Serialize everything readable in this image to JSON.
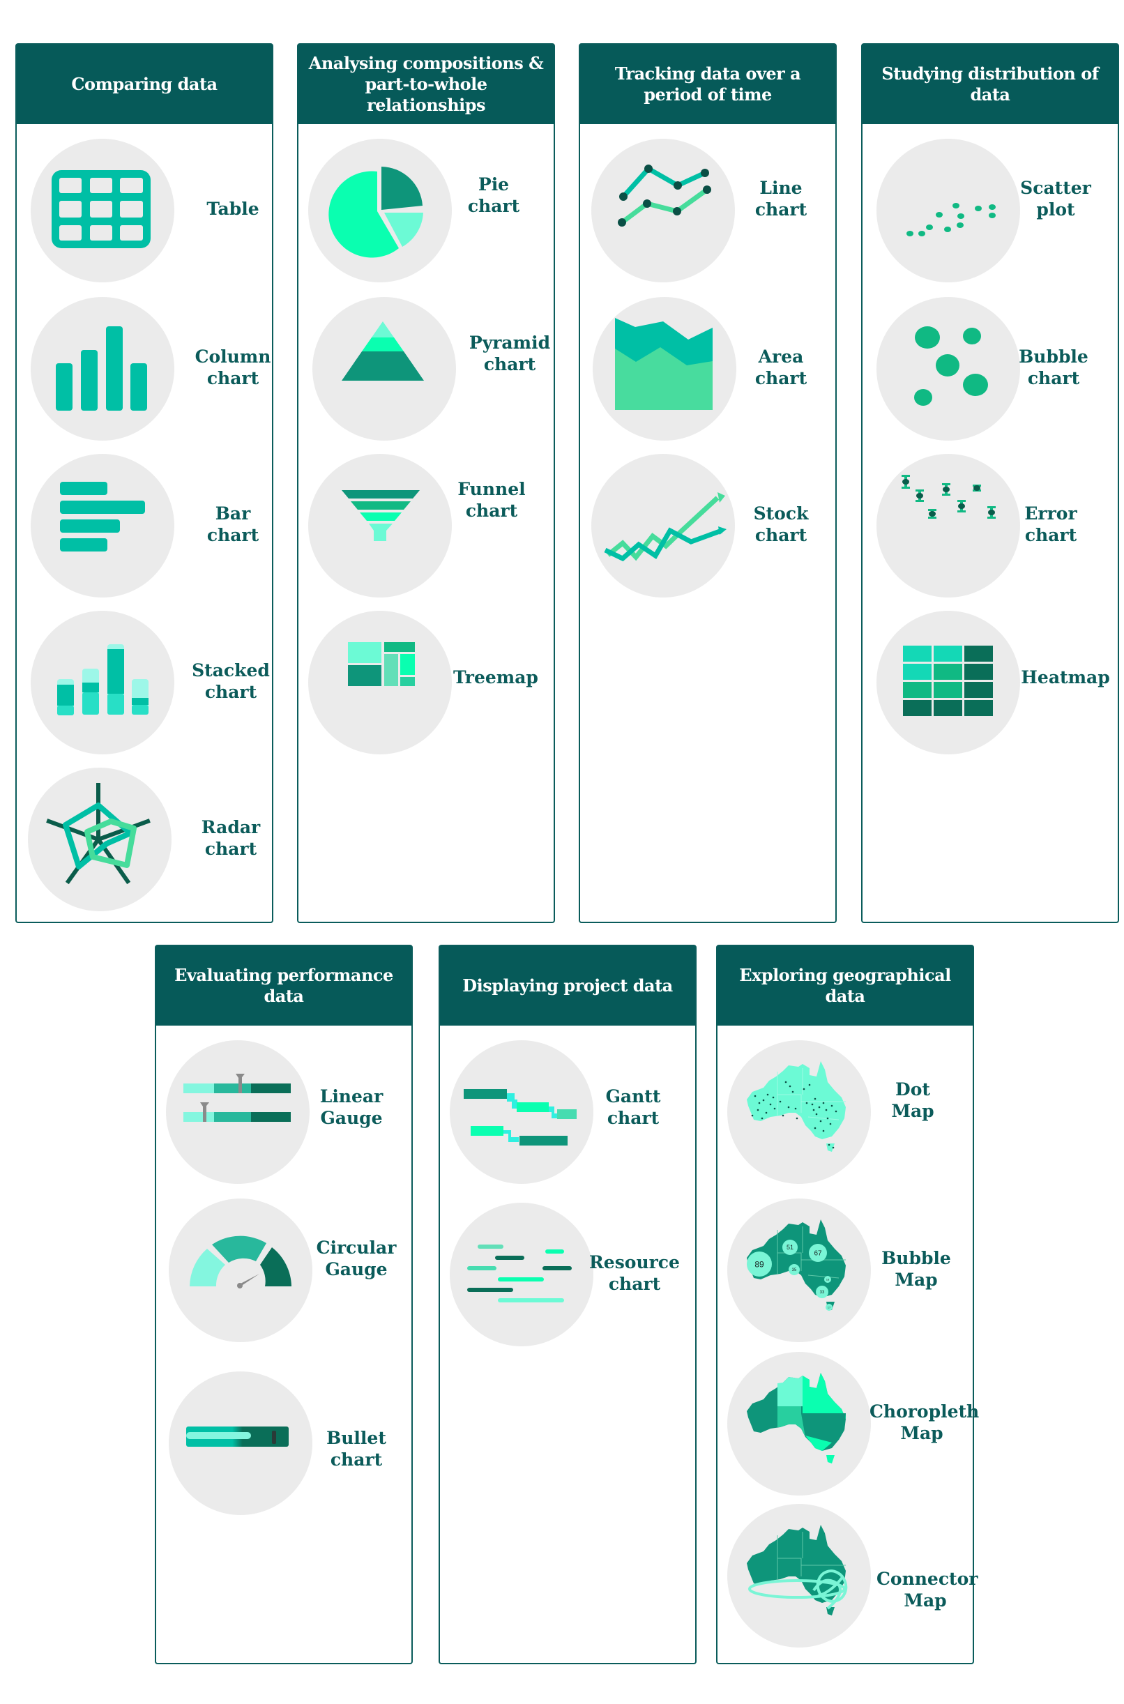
{
  "colors": {
    "header_bg": "#065a59",
    "border": "#0a5c5b",
    "label_text": "#0b5b5a",
    "circle_bg": "#ebebeb",
    "teal": "#00bfa5",
    "dark_green": "#0a7256",
    "mint": "#7af5d6",
    "bright_mint": "#0affb0"
  },
  "panels": [
    {
      "title": "Comparing data",
      "items": [
        {
          "label": "Table",
          "icon": "table-icon"
        },
        {
          "label": "Column chart",
          "icon": "column-chart-icon"
        },
        {
          "label": "Bar chart",
          "icon": "bar-chart-icon"
        },
        {
          "label": "Stacked chart",
          "icon": "stacked-chart-icon"
        },
        {
          "label": "Radar chart",
          "icon": "radar-chart-icon"
        }
      ]
    },
    {
      "title": "Analysing compositions & part-to-whole relationships",
      "items": [
        {
          "label": "Pie chart",
          "icon": "pie-chart-icon"
        },
        {
          "label": "Pyramid chart",
          "icon": "pyramid-chart-icon"
        },
        {
          "label": "Funnel chart",
          "icon": "funnel-chart-icon"
        },
        {
          "label": "Treemap",
          "icon": "treemap-icon"
        }
      ]
    },
    {
      "title": "Tracking data over a period of time",
      "items": [
        {
          "label": "Line chart",
          "icon": "line-chart-icon"
        },
        {
          "label": "Area chart",
          "icon": "area-chart-icon"
        },
        {
          "label": "Stock chart",
          "icon": "stock-chart-icon"
        }
      ]
    },
    {
      "title": "Studying distribution of data",
      "items": [
        {
          "label": "Scatter plot",
          "icon": "scatter-plot-icon"
        },
        {
          "label": "Bubble chart",
          "icon": "bubble-chart-icon"
        },
        {
          "label": "Error chart",
          "icon": "error-chart-icon"
        },
        {
          "label": "Heatmap",
          "icon": "heatmap-icon"
        }
      ]
    },
    {
      "title": "Evaluating performance data",
      "items": [
        {
          "label": "Linear Gauge",
          "icon": "linear-gauge-icon"
        },
        {
          "label": "Circular Gauge",
          "icon": "circular-gauge-icon"
        },
        {
          "label": "Bullet chart",
          "icon": "bullet-chart-icon"
        }
      ]
    },
    {
      "title": "Displaying project data",
      "items": [
        {
          "label": "Gantt chart",
          "icon": "gantt-chart-icon"
        },
        {
          "label": "Resource chart",
          "icon": "resource-chart-icon"
        }
      ]
    },
    {
      "title": "Exploring geographical data",
      "items": [
        {
          "label": "Dot Map",
          "icon": "dot-map-icon"
        },
        {
          "label": "Bubble Map",
          "icon": "bubble-map-icon",
          "bubble_values": [
            "89",
            "51",
            "67",
            "35",
            "18",
            "33",
            "17"
          ]
        },
        {
          "label": "Choropleth Map",
          "icon": "choropleth-map-icon"
        },
        {
          "label": "Connector Map",
          "icon": "connector-map-icon"
        }
      ]
    }
  ]
}
